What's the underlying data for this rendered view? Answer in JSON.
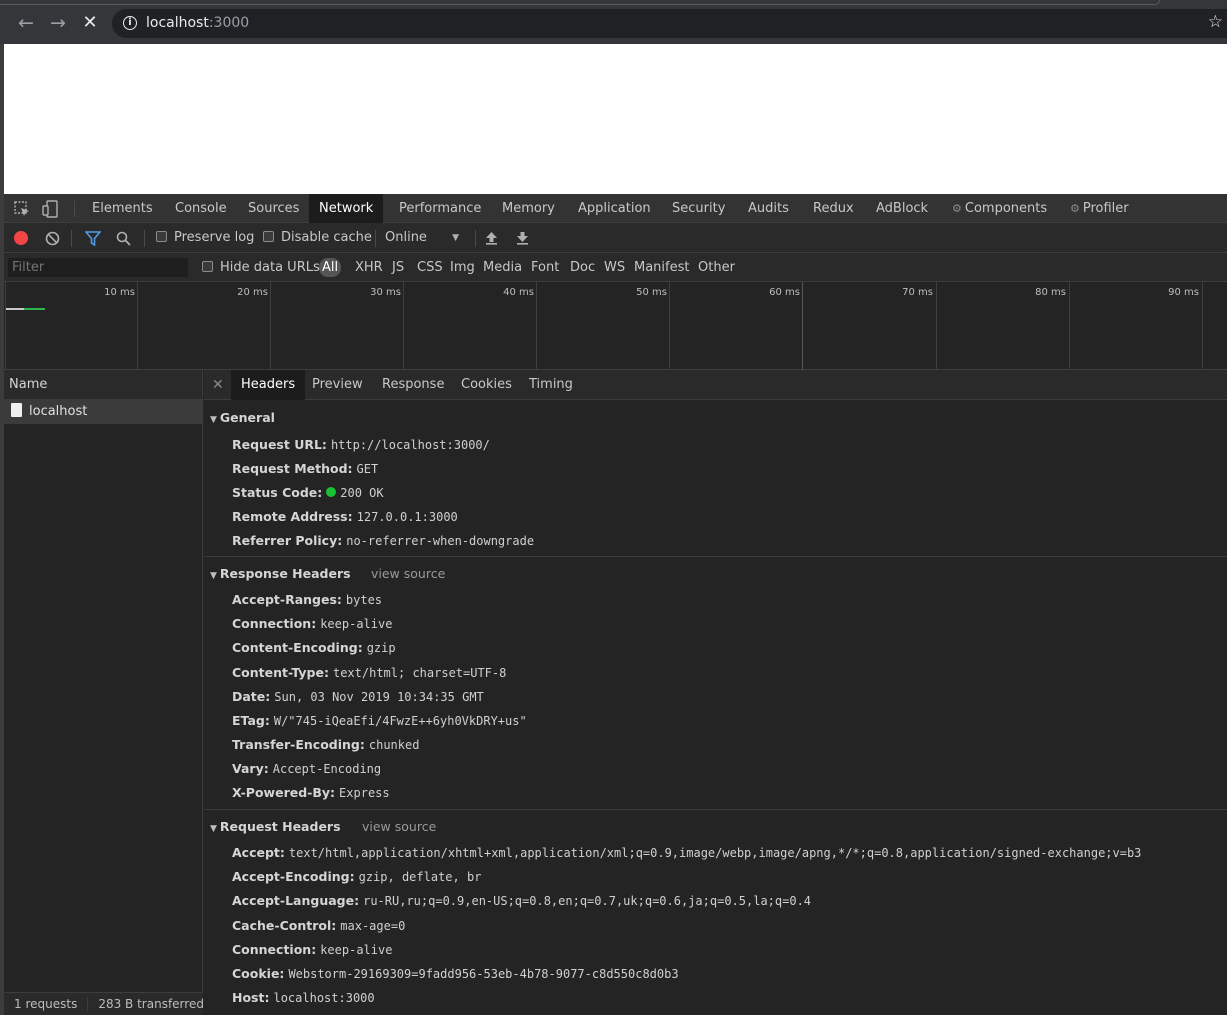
{
  "browser": {
    "url_host": "localhost",
    "url_port": ":3000",
    "icons": {
      "back": "back-arrow-icon",
      "forward": "forward-arrow-icon",
      "stop": "stop-icon",
      "info": "info-icon",
      "bookmark": "star-icon"
    }
  },
  "devtools": {
    "tabs": [
      "Elements",
      "Console",
      "Sources",
      "Network",
      "Performance",
      "Memory",
      "Application",
      "Security",
      "Audits",
      "Redux",
      "AdBlock",
      "Components",
      "Profiler"
    ],
    "active_tab": "Network",
    "toolbar": {
      "preserve_log": "Preserve log",
      "disable_cache": "Disable cache",
      "throttle": "Online"
    },
    "filter": {
      "placeholder": "Filter",
      "hide_data_urls": "Hide data URLs",
      "types": [
        "All",
        "XHR",
        "JS",
        "CSS",
        "Img",
        "Media",
        "Font",
        "Doc",
        "WS",
        "Manifest",
        "Other"
      ],
      "active_type": "All"
    },
    "overview": {
      "ticks": [
        "10 ms",
        "20 ms",
        "30 ms",
        "40 ms",
        "50 ms",
        "60 ms",
        "70 ms",
        "80 ms",
        "90 ms"
      ]
    },
    "requests": {
      "column_name": "Name",
      "items": [
        "localhost"
      ],
      "summary_count": "1 requests",
      "summary_transferred": "283 B transferred"
    },
    "detail": {
      "tabs": [
        "Headers",
        "Preview",
        "Response",
        "Cookies",
        "Timing"
      ],
      "active_tab": "Headers",
      "general": {
        "title": "General",
        "rows": [
          {
            "k": "Request URL:",
            "v": "http://localhost:3000/"
          },
          {
            "k": "Request Method:",
            "v": "GET"
          },
          {
            "k": "Status Code:",
            "v": "200 OK",
            "status_color": "#18c233"
          },
          {
            "k": "Remote Address:",
            "v": "127.0.0.1:3000"
          },
          {
            "k": "Referrer Policy:",
            "v": "no-referrer-when-downgrade"
          }
        ]
      },
      "response_headers": {
        "title": "Response Headers",
        "view_source": "view source",
        "rows": [
          {
            "k": "Accept-Ranges:",
            "v": "bytes"
          },
          {
            "k": "Connection:",
            "v": "keep-alive"
          },
          {
            "k": "Content-Encoding:",
            "v": "gzip"
          },
          {
            "k": "Content-Type:",
            "v": "text/html; charset=UTF-8"
          },
          {
            "k": "Date:",
            "v": "Sun, 03 Nov 2019 10:34:35 GMT"
          },
          {
            "k": "ETag:",
            "v": "W/\"745-iQeaEfi/4FwzE++6yh0VkDRY+us\""
          },
          {
            "k": "Transfer-Encoding:",
            "v": "chunked"
          },
          {
            "k": "Vary:",
            "v": "Accept-Encoding"
          },
          {
            "k": "X-Powered-By:",
            "v": "Express"
          }
        ]
      },
      "request_headers": {
        "title": "Request Headers",
        "view_source": "view source",
        "rows": [
          {
            "k": "Accept:",
            "v": "text/html,application/xhtml+xml,application/xml;q=0.9,image/webp,image/apng,*/*;q=0.8,application/signed-exchange;v=b3"
          },
          {
            "k": "Accept-Encoding:",
            "v": "gzip, deflate, br"
          },
          {
            "k": "Accept-Language:",
            "v": "ru-RU,ru;q=0.9,en-US;q=0.8,en;q=0.7,uk;q=0.6,ja;q=0.5,la;q=0.4"
          },
          {
            "k": "Cache-Control:",
            "v": "max-age=0"
          },
          {
            "k": "Connection:",
            "v": "keep-alive"
          },
          {
            "k": "Cookie:",
            "v": "Webstorm-29169309=9fadd956-53eb-4b78-9077-c8d550c8d0b3"
          },
          {
            "k": "Host:",
            "v": "localhost:3000"
          }
        ]
      }
    }
  }
}
